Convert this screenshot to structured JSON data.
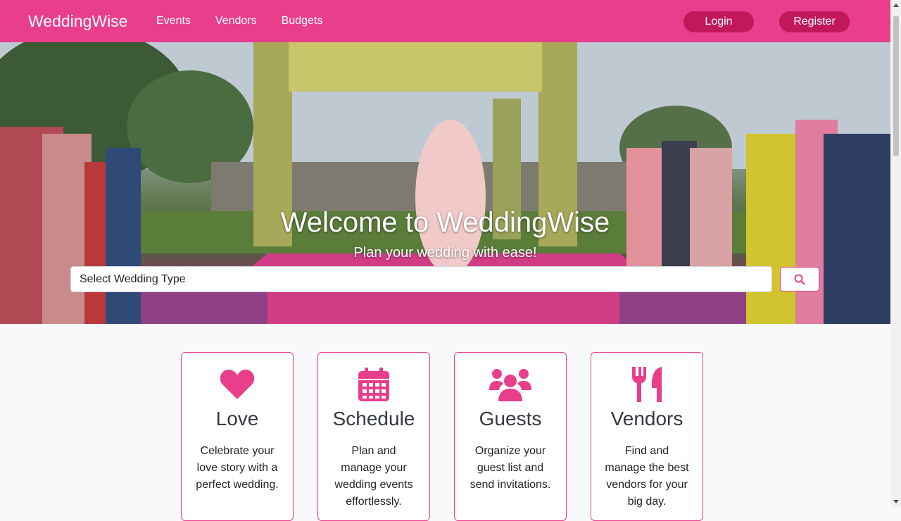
{
  "navbar": {
    "brand": "WeddingWise",
    "links": [
      "Events",
      "Vendors",
      "Budgets"
    ],
    "login_label": "Login",
    "register_label": "Register"
  },
  "hero": {
    "title": "Welcome to WeddingWise",
    "subtitle": "Plan your wedding with ease!",
    "search_value": "Select Wedding Type",
    "search_icon": "search-icon"
  },
  "features": [
    {
      "icon": "heart-icon",
      "title": "Love",
      "text": "Celebrate your love story with a perfect wedding."
    },
    {
      "icon": "calendar-icon",
      "title": "Schedule",
      "text": "Plan and manage your wedding events effortlessly."
    },
    {
      "icon": "users-icon",
      "title": "Guests",
      "text": "Organize your guest list and send invitations."
    },
    {
      "icon": "utensils-icon",
      "title": "Vendors",
      "text": "Find and manage the best vendors for your big day."
    }
  ],
  "colors": {
    "brand": "#e83e8c",
    "button_dark": "#c2185b",
    "page_bg": "#f8f9fa"
  }
}
